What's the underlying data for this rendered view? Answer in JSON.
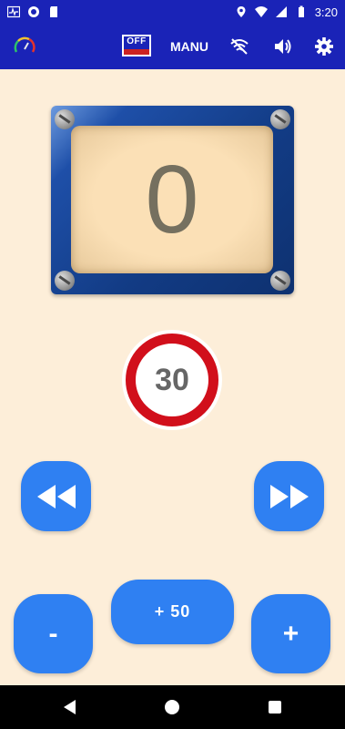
{
  "status_bar": {
    "time": "3:20",
    "icons": [
      "activity-icon",
      "circle-app-icon",
      "sd-card-icon",
      "location-icon",
      "wifi-icon",
      "signal-icon",
      "battery-icon"
    ]
  },
  "app_bar": {
    "speedometer_icon": "speedometer-icon",
    "off_badge_label": "OFF",
    "mode_label": "MANU",
    "wifi_off_icon": "wifi-off-icon",
    "volume_icon": "volume-icon",
    "settings_icon": "gear-icon"
  },
  "counter": {
    "value": "0"
  },
  "speed_limit": {
    "value": "30"
  },
  "buttons": {
    "rewind_icon": "rewind-icon",
    "forward_icon": "fast-forward-icon",
    "minus_label": "-",
    "plus50_label": "+ 50",
    "plus_label": "+"
  },
  "colors": {
    "primary": "#1a23b7",
    "button": "#2f80f2",
    "background": "#fdeed9",
    "sign_red": "#d10f1b"
  }
}
